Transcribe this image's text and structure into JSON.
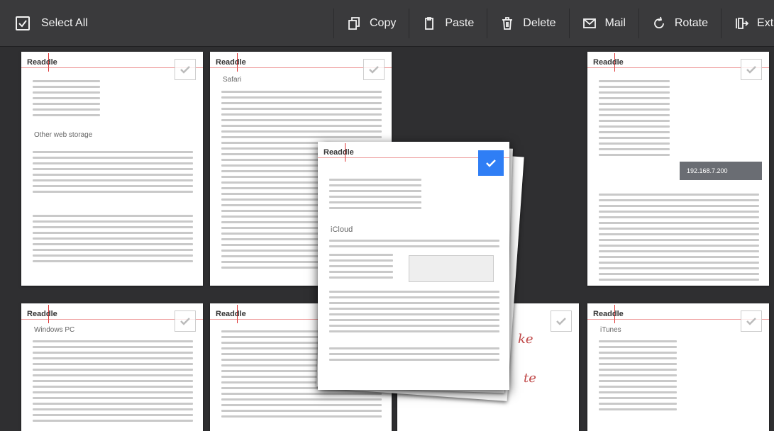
{
  "toolbar": {
    "select_all": "Select All",
    "tools": [
      {
        "label": "Copy",
        "icon": "copy-icon"
      },
      {
        "label": "Paste",
        "icon": "paste-icon"
      },
      {
        "label": "Delete",
        "icon": "trash-icon"
      },
      {
        "label": "Mail",
        "icon": "mail-icon"
      },
      {
        "label": "Rotate",
        "icon": "rotate-icon"
      },
      {
        "label": "Extract",
        "icon": "extract-icon"
      }
    ]
  },
  "brand": "Readdle",
  "pages": {
    "p1": {
      "heading": "Other web storage",
      "checked": false
    },
    "p2": {
      "heading": "Safari",
      "checked": false
    },
    "p3": {
      "heading": "",
      "checked": false
    },
    "p4": {
      "heading": "Windows PC",
      "checked": false
    },
    "p5": {
      "heading": "",
      "checked": false
    },
    "p6": {
      "heading": "",
      "checked": false
    },
    "p7": {
      "heading": "iTunes",
      "checked": false
    },
    "dragged": {
      "heading": "iCloud",
      "checked": true
    }
  },
  "status": {
    "ip_address": "192.168.7.200"
  },
  "handwriting": [
    "ke",
    "te"
  ],
  "colors": {
    "accent": "#2f7ef5",
    "toolbar_bg": "#3a3a3c",
    "background": "#2f2f31",
    "brand_red": "#d33"
  }
}
